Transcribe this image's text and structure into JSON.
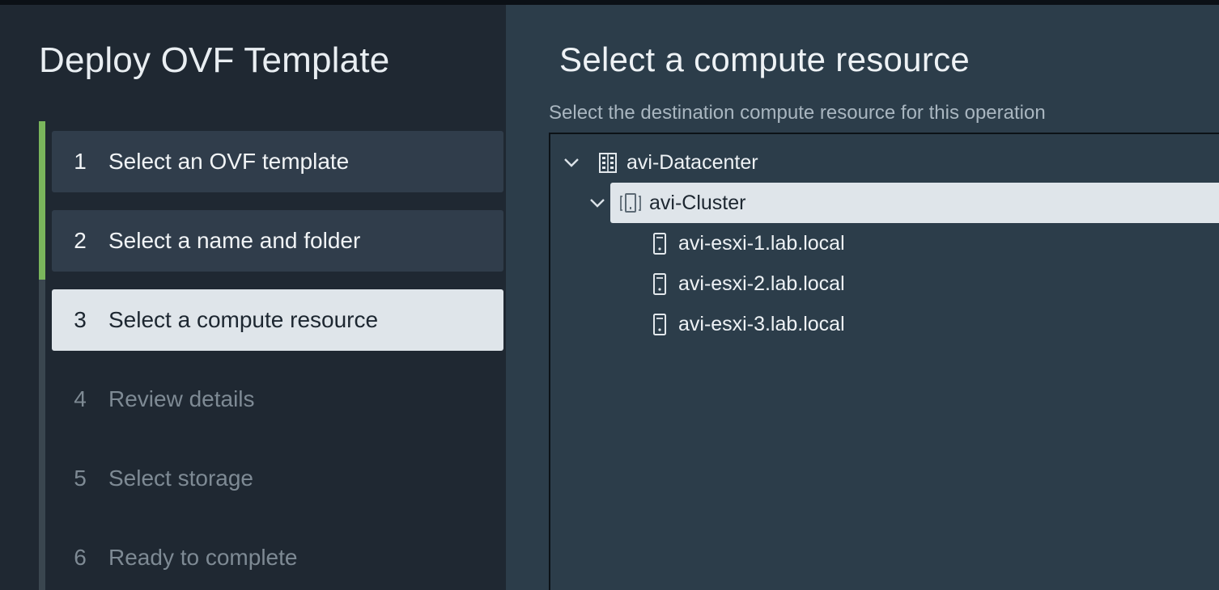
{
  "wizard": {
    "title": "Deploy OVF Template",
    "steps": [
      {
        "number": "1",
        "label": "Select an OVF template",
        "state": "completed"
      },
      {
        "number": "2",
        "label": "Select a name and folder",
        "state": "completed"
      },
      {
        "number": "3",
        "label": "Select a compute resource",
        "state": "current"
      },
      {
        "number": "4",
        "label": "Review details",
        "state": "pending"
      },
      {
        "number": "5",
        "label": "Select storage",
        "state": "pending"
      },
      {
        "number": "6",
        "label": "Ready to complete",
        "state": "pending"
      }
    ]
  },
  "page": {
    "title": "Select a compute resource",
    "subtitle": "Select the destination compute resource for this operation"
  },
  "tree": {
    "datacenter": {
      "label": "avi-Datacenter",
      "icon": "datacenter-icon",
      "expanded": true
    },
    "cluster": {
      "label": "avi-Cluster",
      "icon": "cluster-icon",
      "expanded": true,
      "selected": true
    },
    "hosts": [
      {
        "label": "avi-esxi-1.lab.local",
        "icon": "host-icon"
      },
      {
        "label": "avi-esxi-2.lab.local",
        "icon": "host-icon"
      },
      {
        "label": "avi-esxi-3.lab.local",
        "icon": "host-icon"
      }
    ]
  },
  "colors": {
    "progress_done": "#7ab55c",
    "sidebar_bg": "#1f2832",
    "content_bg": "#2c3d4a",
    "selected_bg": "#dfe5ea"
  }
}
